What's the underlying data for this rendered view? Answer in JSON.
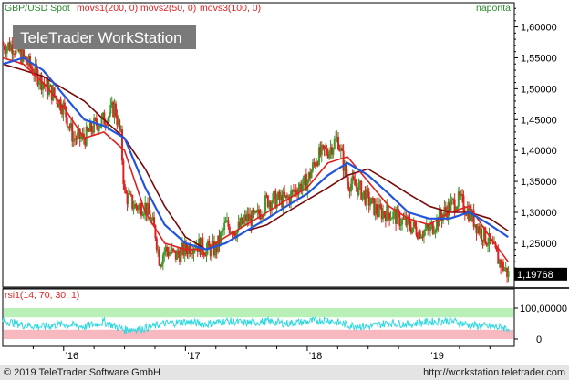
{
  "header": {
    "symbol": "GBP/USD Spot",
    "indicators": [
      "movs1(200, 0)",
      "movs2(50, 0)",
      "movs3(100, 0)"
    ],
    "period": "naponta",
    "watermark": "TeleTrader WorkStation"
  },
  "footer": {
    "copyright": "© 2019 TeleTrader Software GmbH",
    "url": "http://workstation.teletrader.com"
  },
  "colors": {
    "price": "#e02020",
    "candle_up": "#3a9a2a",
    "candle_down": "#e02020",
    "movs1": "#7a0a0a",
    "movs2": "#e02020",
    "movs3": "#2255dd",
    "rsi_line": "#30d8e0",
    "rsi_upper_band": "#b8f0b8",
    "rsi_lower_band": "#f8b8c0",
    "last_price_badge": "#000000"
  },
  "chart_data": [
    {
      "type": "line",
      "title": "GBP/USD Spot",
      "x_ticks": [
        "'16",
        "'17",
        "'18",
        "'19"
      ],
      "y_ticks": [
        "1,60000",
        "1,55000",
        "1,50000",
        "1,45000",
        "1,40000",
        "1,35000",
        "1,30000",
        "1,25000",
        "1,20000"
      ],
      "ylim": [
        1.185,
        1.62
      ],
      "last_value_label": "1,19768",
      "grid": false,
      "series": [
        {
          "name": "GBP/USD Spot",
          "x": [
            2015.5,
            2015.58,
            2015.67,
            2015.75,
            2015.83,
            2015.92,
            2016.0,
            2016.08,
            2016.17,
            2016.25,
            2016.33,
            2016.42,
            2016.47,
            2016.5,
            2016.58,
            2016.67,
            2016.75,
            2016.79,
            2016.83,
            2016.92,
            2017.0,
            2017.08,
            2017.17,
            2017.25,
            2017.33,
            2017.42,
            2017.5,
            2017.58,
            2017.67,
            2017.75,
            2017.83,
            2017.92,
            2018.0,
            2018.08,
            2018.17,
            2018.25,
            2018.33,
            2018.42,
            2018.5,
            2018.58,
            2018.67,
            2018.75,
            2018.83,
            2018.92,
            2019.0,
            2019.08,
            2019.17,
            2019.25,
            2019.33,
            2019.42,
            2019.5,
            2019.58,
            2019.65
          ],
          "values": [
            1.57,
            1.57,
            1.55,
            1.53,
            1.51,
            1.49,
            1.47,
            1.42,
            1.42,
            1.44,
            1.45,
            1.47,
            1.42,
            1.33,
            1.31,
            1.31,
            1.27,
            1.22,
            1.24,
            1.23,
            1.24,
            1.25,
            1.24,
            1.24,
            1.28,
            1.27,
            1.29,
            1.29,
            1.32,
            1.32,
            1.32,
            1.34,
            1.35,
            1.39,
            1.4,
            1.42,
            1.35,
            1.34,
            1.32,
            1.3,
            1.3,
            1.29,
            1.28,
            1.27,
            1.27,
            1.29,
            1.31,
            1.32,
            1.3,
            1.27,
            1.25,
            1.22,
            1.2
          ]
        },
        {
          "name": "movs1(200, 0)",
          "x": [
            2015.5,
            2015.67,
            2015.83,
            2016.0,
            2016.17,
            2016.33,
            2016.5,
            2016.67,
            2016.83,
            2017.0,
            2017.17,
            2017.33,
            2017.5,
            2017.67,
            2017.83,
            2018.0,
            2018.17,
            2018.33,
            2018.5,
            2018.67,
            2018.83,
            2019.0,
            2019.17,
            2019.33,
            2019.5,
            2019.65
          ],
          "values": [
            1.54,
            1.53,
            1.52,
            1.5,
            1.48,
            1.45,
            1.42,
            1.37,
            1.31,
            1.26,
            1.24,
            1.25,
            1.27,
            1.28,
            1.3,
            1.32,
            1.34,
            1.36,
            1.37,
            1.35,
            1.33,
            1.31,
            1.3,
            1.3,
            1.29,
            1.27
          ]
        },
        {
          "name": "movs2(50, 0)",
          "x": [
            2015.5,
            2015.67,
            2015.83,
            2016.0,
            2016.17,
            2016.33,
            2016.5,
            2016.67,
            2016.83,
            2017.0,
            2017.17,
            2017.33,
            2017.5,
            2017.67,
            2017.83,
            2018.0,
            2018.17,
            2018.33,
            2018.5,
            2018.67,
            2018.83,
            2019.0,
            2019.17,
            2019.33,
            2019.5,
            2019.65
          ],
          "values": [
            1.55,
            1.54,
            1.51,
            1.47,
            1.42,
            1.43,
            1.4,
            1.3,
            1.25,
            1.24,
            1.24,
            1.26,
            1.28,
            1.3,
            1.32,
            1.34,
            1.38,
            1.39,
            1.35,
            1.31,
            1.29,
            1.28,
            1.3,
            1.31,
            1.26,
            1.22
          ]
        },
        {
          "name": "movs3(100, 0)",
          "x": [
            2015.5,
            2015.67,
            2015.83,
            2016.0,
            2016.17,
            2016.33,
            2016.5,
            2016.67,
            2016.83,
            2017.0,
            2017.17,
            2017.33,
            2017.5,
            2017.67,
            2017.83,
            2018.0,
            2018.17,
            2018.33,
            2018.5,
            2018.67,
            2018.83,
            2019.0,
            2019.17,
            2019.33,
            2019.5,
            2019.65
          ],
          "values": [
            1.54,
            1.55,
            1.53,
            1.49,
            1.45,
            1.44,
            1.42,
            1.34,
            1.28,
            1.25,
            1.24,
            1.25,
            1.27,
            1.29,
            1.31,
            1.33,
            1.36,
            1.38,
            1.36,
            1.33,
            1.3,
            1.29,
            1.29,
            1.3,
            1.28,
            1.26
          ]
        }
      ]
    },
    {
      "type": "line",
      "title": "rsi1(14, 70, 30, 1)",
      "y_ticks": [
        "100,00000",
        "0"
      ],
      "ylim": [
        0,
        100
      ],
      "bands": [
        70,
        30
      ],
      "series": [
        {
          "name": "rsi1(14, 70, 30, 1)",
          "x": [
            2015.5,
            2015.67,
            2015.83,
            2016.0,
            2016.17,
            2016.33,
            2016.5,
            2016.67,
            2016.83,
            2017.0,
            2017.17,
            2017.33,
            2017.5,
            2017.67,
            2017.83,
            2018.0,
            2018.17,
            2018.33,
            2018.5,
            2018.67,
            2018.83,
            2019.0,
            2019.17,
            2019.33,
            2019.5,
            2019.65
          ],
          "values": [
            60,
            45,
            40,
            48,
            40,
            55,
            30,
            35,
            50,
            55,
            48,
            58,
            52,
            57,
            50,
            56,
            62,
            45,
            40,
            52,
            48,
            55,
            60,
            45,
            40,
            35
          ]
        }
      ]
    }
  ]
}
